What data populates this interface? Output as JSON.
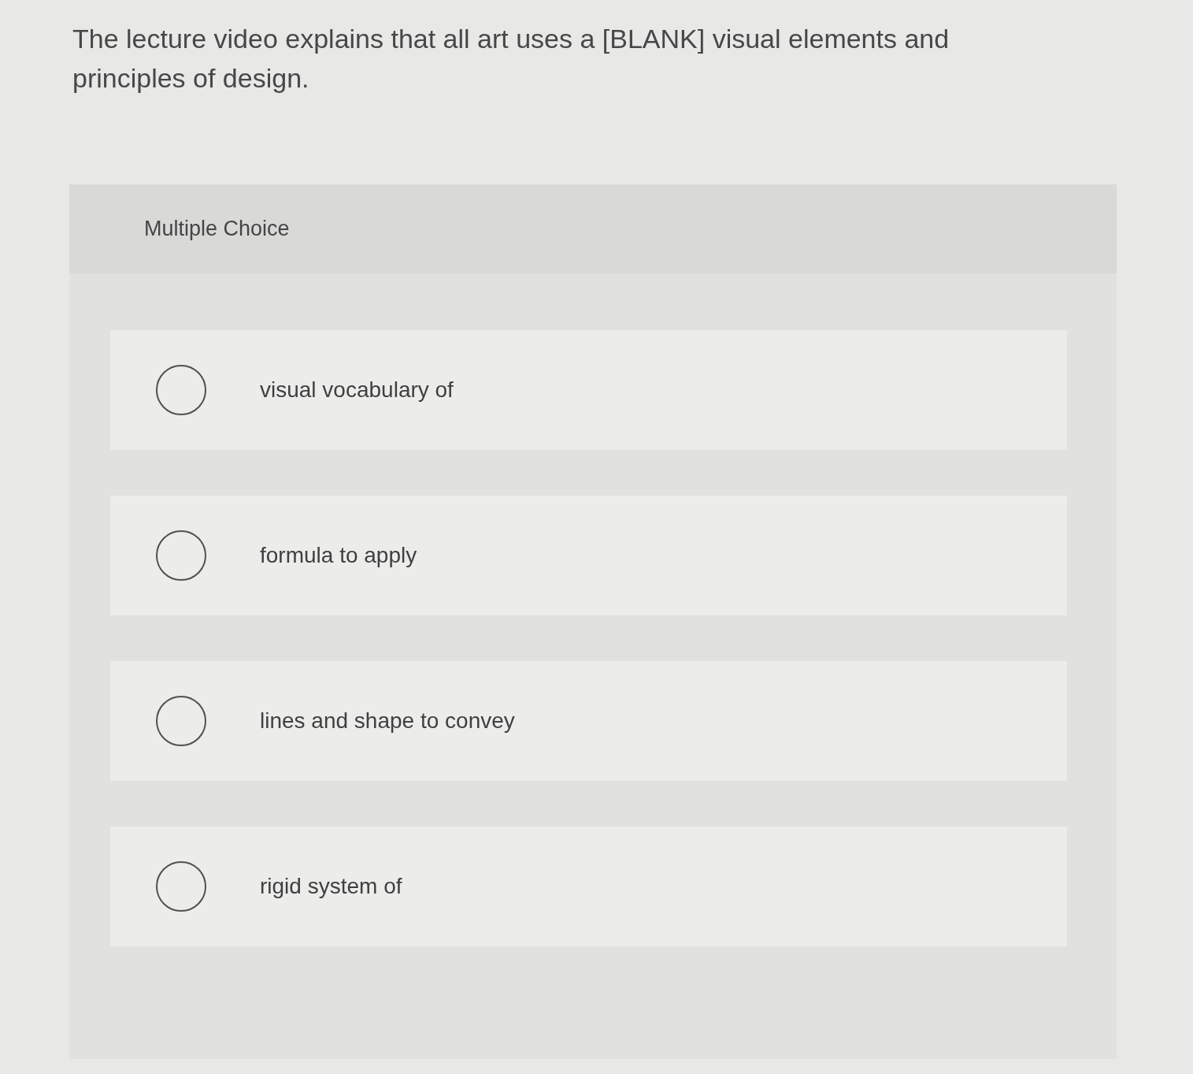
{
  "question": {
    "text": "The lecture video explains that all art uses a [BLANK] visual elements and principles of design."
  },
  "answer_panel": {
    "type_label": "Multiple Choice",
    "options": [
      {
        "label": "visual vocabulary of",
        "selected": false
      },
      {
        "label": "formula to apply",
        "selected": false
      },
      {
        "label": "lines and shape to convey",
        "selected": false
      },
      {
        "label": "rigid system of",
        "selected": false
      }
    ]
  }
}
